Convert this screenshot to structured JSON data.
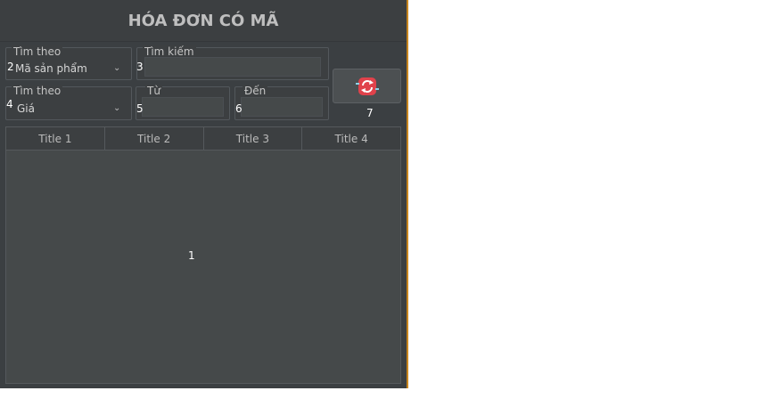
{
  "title": "HÓA ĐƠN CÓ MÃ",
  "search_by_1": {
    "label": "Tìm theo",
    "value": "Mã sản phẩm",
    "marker": "2"
  },
  "keyword": {
    "label": "Tìm kiếm",
    "value": "",
    "marker": "3"
  },
  "search_by_2": {
    "label": "Tìm theo",
    "value": "Giá",
    "marker": "4"
  },
  "from": {
    "label": "Từ",
    "value": "",
    "marker": "5"
  },
  "to": {
    "label": "Đến",
    "value": "",
    "marker": "6"
  },
  "refresh": {
    "icon": "refresh-icon",
    "marker": "7"
  },
  "table": {
    "columns": [
      "Title 1",
      "Title 2",
      "Title 3",
      "Title 4"
    ],
    "rows": [],
    "marker": "1"
  },
  "colors": {
    "panel": "#3b3f42",
    "accent_edge": "#c8861f",
    "refresh_icon": "#e0424b"
  }
}
